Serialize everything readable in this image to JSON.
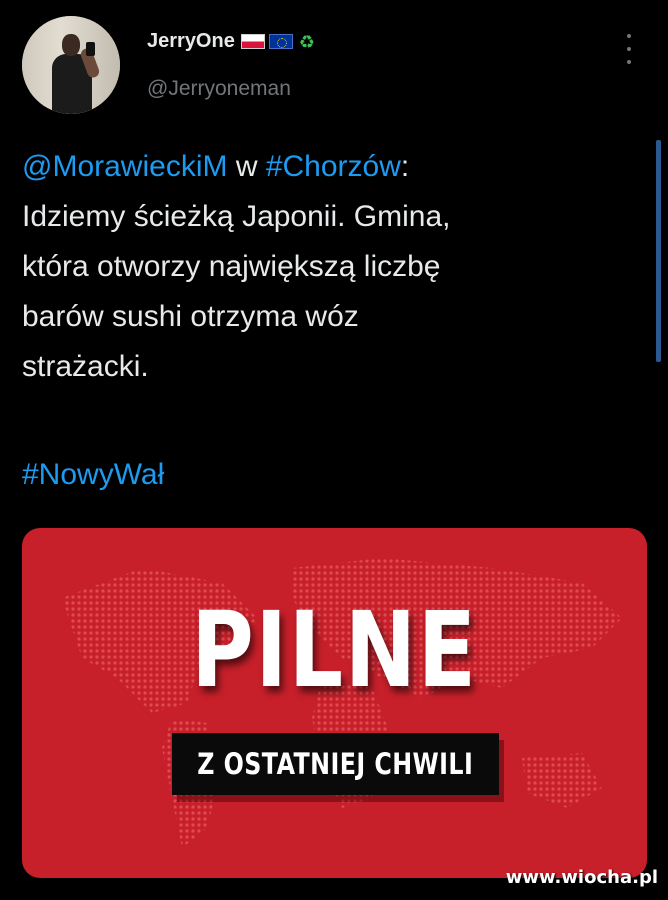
{
  "author": {
    "display_name": "JerryOne",
    "handle": "@Jerryoneman",
    "badges": [
      "poland-flag-icon",
      "eu-flag-icon",
      "recycle-icon"
    ],
    "recycle_glyph": "♻"
  },
  "tweet": {
    "mention": "@MorawieckiM",
    "connector": " w ",
    "hashtag_city": "#Chorzów",
    "colon": ":",
    "lines": [
      "Idziemy ścieżką Japonii. Gmina,",
      "która otworzy największą liczbę",
      "barów sushi otrzyma wóz",
      "strażacki."
    ],
    "hashtag": "#NowyWał"
  },
  "media": {
    "headline": "PILNE",
    "subheadline": "Z OSTATNIEJ CHWILI",
    "background_color": "#c8202a"
  },
  "watermark": "www.wiocha.pl",
  "colors": {
    "background": "#000000",
    "text": "#e7e9ea",
    "secondary": "#71767b",
    "link": "#1d9bf0"
  }
}
